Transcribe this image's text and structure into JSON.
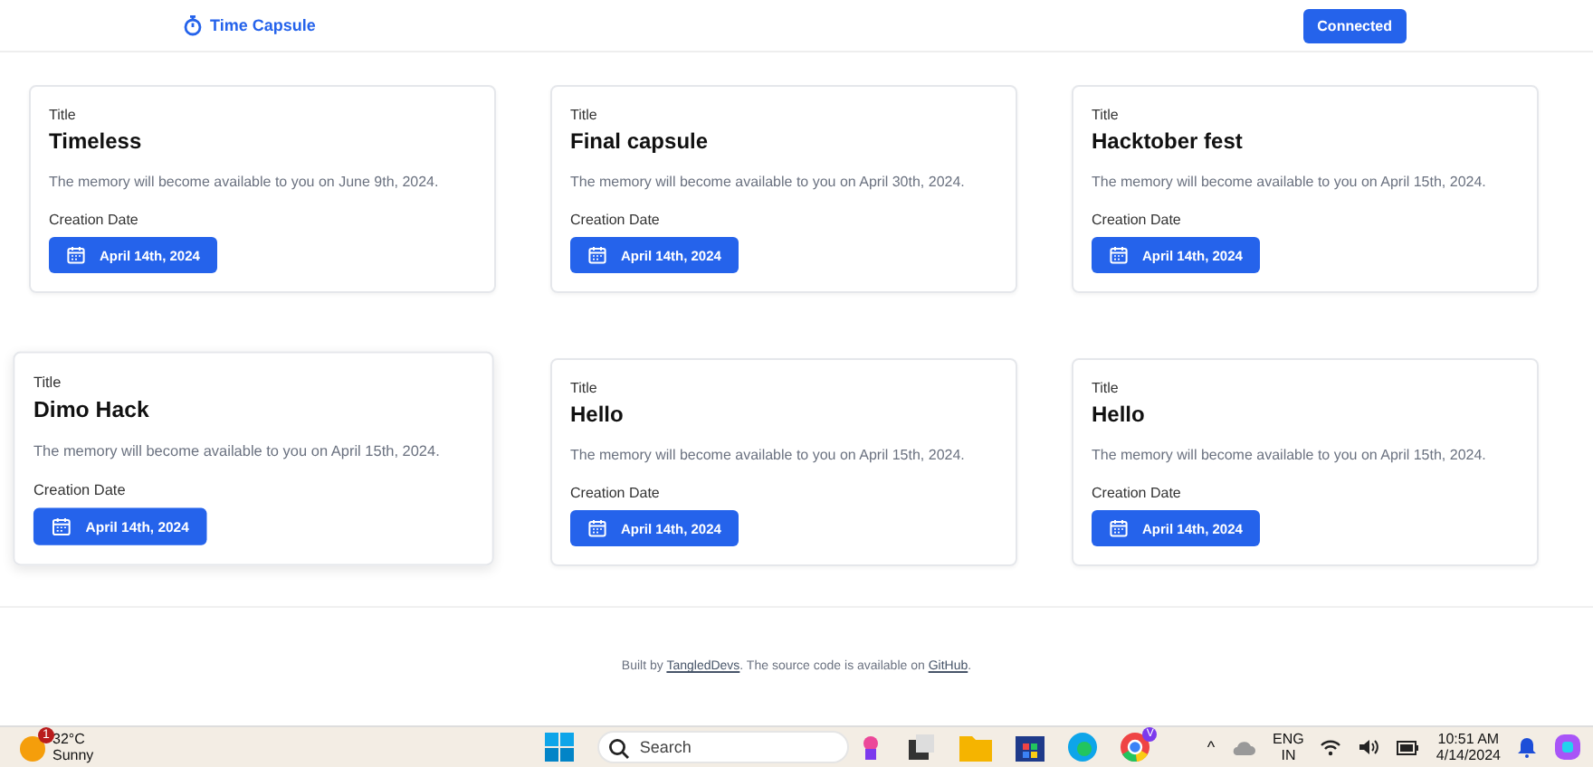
{
  "header": {
    "brand": "Time Capsule",
    "connect_button": "Connected"
  },
  "capsules": [
    {
      "title_label": "Title",
      "title": "Timeless",
      "message": "The memory will become available to you on June 9th, 2024.",
      "date_label": "Creation Date",
      "date": "April 14th, 2024",
      "highlighted": false
    },
    {
      "title_label": "Title",
      "title": "Final capsule",
      "message": "The memory will become available to you on April 30th, 2024.",
      "date_label": "Creation Date",
      "date": "April 14th, 2024",
      "highlighted": false
    },
    {
      "title_label": "Title",
      "title": "Hacktober fest",
      "message": "The memory will become available to you on April 15th, 2024.",
      "date_label": "Creation Date",
      "date": "April 14th, 2024",
      "highlighted": false
    },
    {
      "title_label": "Title",
      "title": "Dimo Hack",
      "message": "The memory will become available to you on April 15th, 2024.",
      "date_label": "Creation Date",
      "date": "April 14th, 2024",
      "highlighted": true
    },
    {
      "title_label": "Title",
      "title": "Hello",
      "message": "The memory will become available to you on April 15th, 2024.",
      "date_label": "Creation Date",
      "date": "April 14th, 2024",
      "highlighted": false
    },
    {
      "title_label": "Title",
      "title": "Hello",
      "message": "The memory will become available to you on April 15th, 2024.",
      "date_label": "Creation Date",
      "date": "April 14th, 2024",
      "highlighted": false
    }
  ],
  "footer": {
    "prefix": "Built by",
    "author_link": "TangledDevs",
    "middle": ". The source code is available on",
    "repo_link": "GitHub",
    "suffix": "."
  },
  "taskbar": {
    "weather_badge": "1",
    "temperature": "32°C",
    "condition": "Sunny",
    "search_placeholder": "Search",
    "chrome_badge": "V",
    "tray_chevron": "^",
    "language": "ENG",
    "region": "IN",
    "time": "10:51 AM",
    "date": "4/14/2024"
  }
}
